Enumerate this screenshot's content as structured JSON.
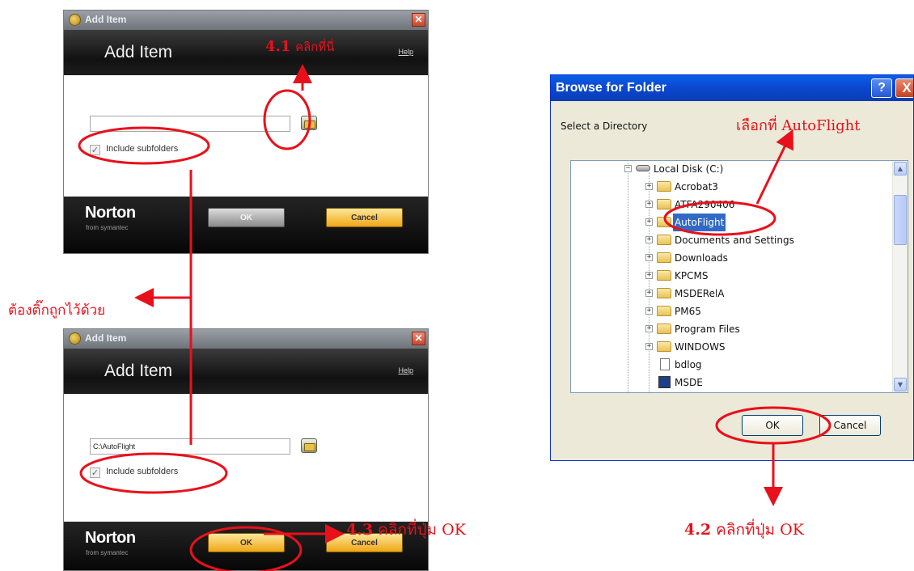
{
  "norton_dialog_top": {
    "title": "Add Item",
    "header_title": "Add Item",
    "help_label": "Help",
    "path_value": "",
    "include_subfolders_label": "Include subfolders",
    "include_subfolders_checked": true,
    "logo": "Norton",
    "logo_sub": "from symantec",
    "ok_label": "OK",
    "cancel_label": "Cancel"
  },
  "norton_dialog_bottom": {
    "title": "Add Item",
    "header_title": "Add Item",
    "help_label": "Help",
    "path_value": "C:\\AutoFlight",
    "include_subfolders_label": "Include subfolders",
    "include_subfolders_checked": true,
    "logo": "Norton",
    "logo_sub": "from symantec",
    "ok_label": "OK",
    "cancel_label": "Cancel"
  },
  "browse_dialog": {
    "title": "Browse for Folder",
    "help_button": "?",
    "close_button": "X",
    "prompt": "Select a Directory",
    "tree_root": "Local Disk (C:)",
    "tree_items": [
      "Acrobat3",
      "ATFA290406",
      "AutoFlight",
      "Documents and Settings",
      "Downloads",
      "KPCMS",
      "MSDERelA",
      "PM65",
      "Program Files",
      "WINDOWS",
      "bdlog",
      "MSDE"
    ],
    "selected_item": "AutoFlight",
    "ok_label": "OK",
    "cancel_label": "Cancel"
  },
  "annotations": {
    "step_41_number": "4.1",
    "step_41_text": "คลิกที่นี่",
    "step_check": "ต้องติ๊กถูกไว้ด้วย",
    "step_select": "เลือกที่ AutoFlight",
    "step_42_number": "4.2",
    "step_42_text": "คลิกที่ปุ่ม OK",
    "step_43_number": "4.3",
    "step_43_text": "คลิกที่ปุ่ม OK"
  },
  "colors": {
    "annotation_red": "#e8111b",
    "norton_header": "#111111",
    "ok_yellow": "#f0a615",
    "xp_blue": "#0b49d1",
    "selection_blue": "#316ac5"
  },
  "icons": [
    "norton-shield-icon",
    "close-icon",
    "folder-browse-icon",
    "checkmark-icon",
    "help-icon",
    "drive-icon",
    "folder-icon",
    "file-icon",
    "scroll-up-icon",
    "scroll-down-icon"
  ]
}
